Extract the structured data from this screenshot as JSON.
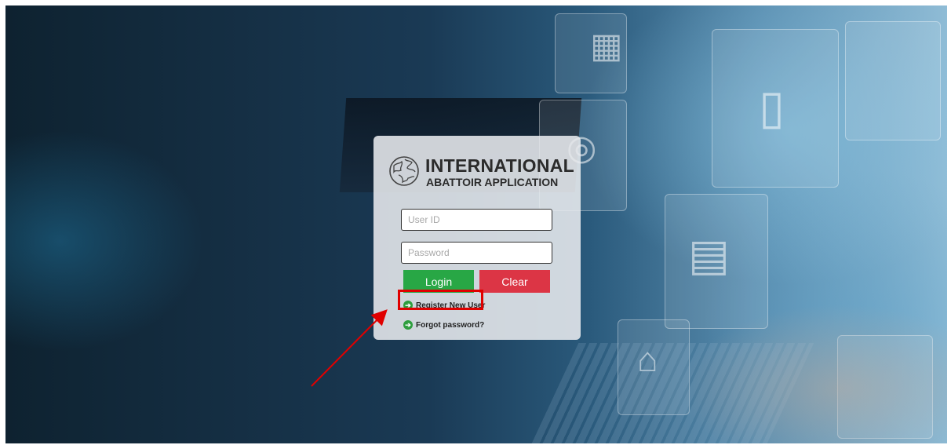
{
  "logo": {
    "title_line1": "INTERNATIONAL",
    "title_line2": "ABATTOIR APPLICATION",
    "icon": "globe-icon"
  },
  "form": {
    "user_id_placeholder": "User ID",
    "user_id_value": "",
    "password_placeholder": "Password",
    "password_value": ""
  },
  "buttons": {
    "login_label": "Login",
    "clear_label": "Clear"
  },
  "links": {
    "register_label": "Register New User",
    "forgot_label": "Forgot password?",
    "icon": "arrow-right-circle-icon"
  },
  "annotation": {
    "highlight_target": "Register New User",
    "arrow_color": "#e00000"
  },
  "colors": {
    "login": "#28a745",
    "clear": "#dc3545",
    "link_icon": "#2e9e3e"
  }
}
